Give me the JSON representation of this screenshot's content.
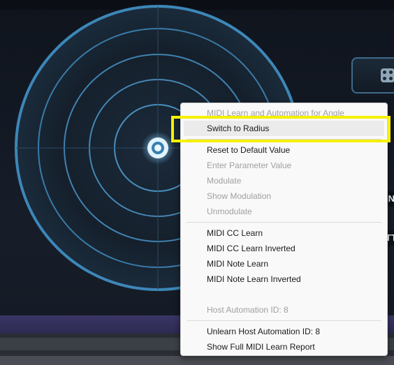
{
  "context_menu": {
    "items": [
      {
        "label": "MIDI Learn and Automation for Angle",
        "enabled": false
      },
      {
        "label": "Switch to Radius",
        "enabled": true,
        "hovered": true
      },
      {
        "label": "Reset to Default Value",
        "enabled": true
      },
      {
        "label": "Enter Parameter Value",
        "enabled": false
      },
      {
        "label": "Modulate",
        "enabled": false
      },
      {
        "label": "Show Modulation",
        "enabled": false
      },
      {
        "label": "Unmodulate",
        "enabled": false
      },
      {
        "label": "MIDI CC Learn",
        "enabled": true
      },
      {
        "label": "MIDI CC Learn Inverted",
        "enabled": true
      },
      {
        "label": "MIDI Note Learn",
        "enabled": true
      },
      {
        "label": "MIDI Note Learn Inverted",
        "enabled": true
      },
      {
        "label": "Host Automation ID: 8",
        "enabled": false
      },
      {
        "label": "Unlearn Host Automation ID: 8",
        "enabled": true
      },
      {
        "label": "Show Full MIDI Learn Report",
        "enabled": true
      }
    ]
  },
  "side_labels": {
    "label_a": "IN",
    "label_b": "TT"
  },
  "colors": {
    "radar_ring": "#4a8fbf",
    "radar_outer": "#3d87b8",
    "highlight": "#f5f000",
    "menu_bg": "#f9f9f9",
    "bottom_band": "#35305e"
  },
  "icons": {
    "randomize": "dice-icon",
    "handle": "radar-handle-icon"
  }
}
